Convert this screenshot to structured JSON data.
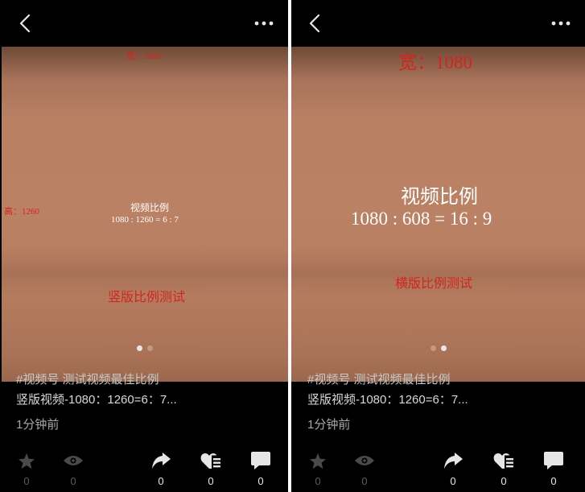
{
  "left": {
    "overlay": {
      "width_label": "宽：1080",
      "height_label": "高：1260",
      "ratio_title": "视频比例",
      "ratio_formula": "1080 : 1260 = 6 : 7",
      "test_label": "竖版比例测试"
    },
    "hashtag_line": "#视频号 测试视频最佳比例",
    "desc_line": "竖版视频-1080：1260=6：7...",
    "time": "1分钟前",
    "counts": {
      "star": "0",
      "view": "0",
      "share": "0",
      "like": "0",
      "comment": "0"
    },
    "carousel": {
      "total": 2,
      "active": 1
    }
  },
  "right": {
    "overlay": {
      "width_label": "宽：1080",
      "ratio_title": "视频比例",
      "ratio_formula": "1080 : 608 = 16 : 9",
      "test_label": "横版比例测试"
    },
    "hashtag_line": "#视频号 测试视频最佳比例",
    "desc_line": "竖版视频-1080：1260=6：7...",
    "time": "1分钟前",
    "counts": {
      "star": "0",
      "view": "0",
      "share": "0",
      "like": "0",
      "comment": "0"
    },
    "carousel": {
      "total": 2,
      "active": 2
    }
  },
  "icons": {
    "back": "chevron-left-icon",
    "more": "more-dots-icon",
    "star": "star-icon",
    "view": "eye-icon",
    "share": "share-arrow-icon",
    "like": "heart-list-icon",
    "comment": "comment-icon"
  },
  "colors": {
    "overlay_red": "#d0261f",
    "overlay_white": "#ffffff",
    "video_tone": "#bb8164"
  }
}
